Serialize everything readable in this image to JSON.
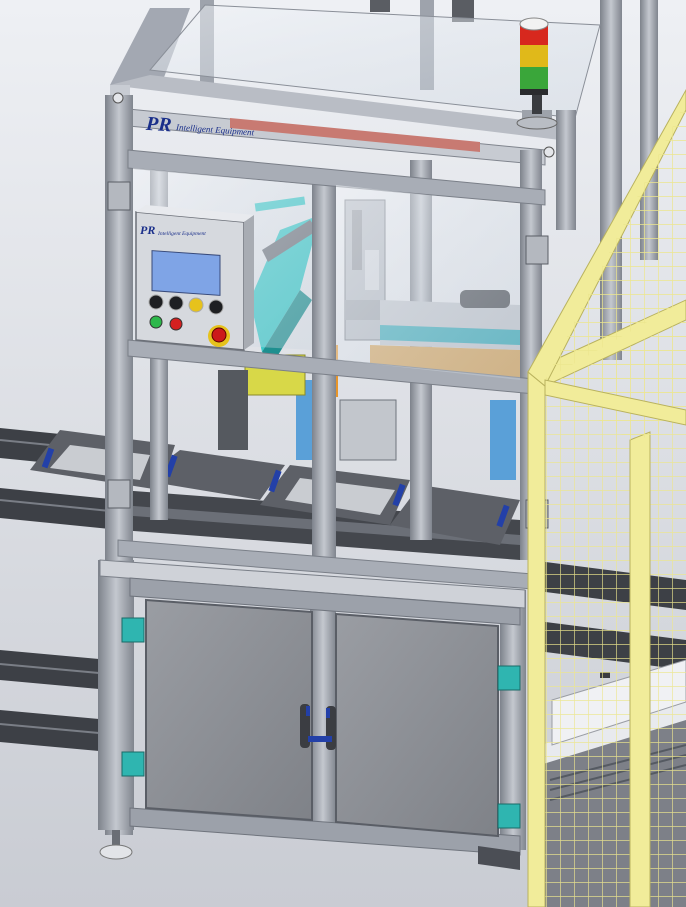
{
  "brand": {
    "logo_mark": "PR",
    "name": "Intelligent Equipment"
  },
  "hmi": {
    "logo_mark": "PR",
    "name": "Intelligent Equipment",
    "button_colors": [
      "#1e1f22",
      "#1e1f22",
      "#e6c21c",
      "#1e1f22",
      "#2db84b",
      "#d42020",
      "#cc1a1a"
    ]
  },
  "tower_light": {
    "colors": [
      "#d7281e",
      "#e0b91a",
      "#3aa63a"
    ]
  },
  "colors": {
    "frame": "#a3a8b2",
    "frame_dark": "#6f747d",
    "guard_yellow": "#f1ec9a",
    "door_panel": "#8c8f94",
    "hinge": "#2fb5b0",
    "handle": "#3b3d42",
    "conveyor": "#3d4046",
    "background": "#d9dce2"
  }
}
